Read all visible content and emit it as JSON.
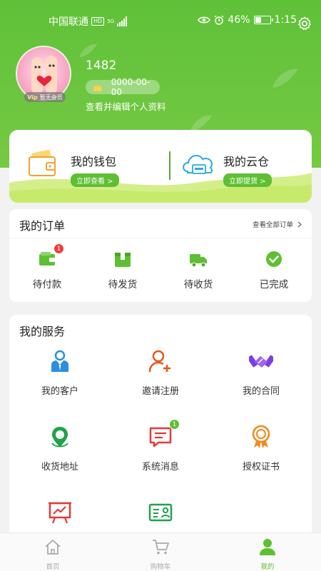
{
  "status_bar": {
    "carrier": "中国联通",
    "hd": "HD",
    "network": "5G",
    "battery": "46%",
    "time": "1:15"
  },
  "profile": {
    "username": "1482",
    "member_date": "0000-00-00",
    "vip_mark": "Vip",
    "vip_status": "暂无会员",
    "edit_link": "查看并编辑个人资料"
  },
  "wallet": {
    "title": "我的钱包",
    "button": "立即查看 >"
  },
  "cloud": {
    "title": "我的云仓",
    "button": "立即提货 >"
  },
  "orders": {
    "title": "我的订单",
    "view_all": "查看全部订单",
    "items": [
      {
        "label": "待付款",
        "badge": "1"
      },
      {
        "label": "待发货"
      },
      {
        "label": "待收货"
      },
      {
        "label": "已完成"
      }
    ]
  },
  "services": {
    "title": "我的服务",
    "items": [
      {
        "label": "我的客户",
        "icon": "customer-icon"
      },
      {
        "label": "邀请注册",
        "icon": "add-user-icon"
      },
      {
        "label": "我的合同",
        "icon": "handshake-icon"
      },
      {
        "label": "收货地址",
        "icon": "location-icon"
      },
      {
        "label": "系统消息",
        "icon": "message-icon",
        "badge": "1"
      },
      {
        "label": "授权证书",
        "icon": "certificate-icon"
      },
      {
        "label": "",
        "icon": "chart-board-icon"
      },
      {
        "label": "",
        "icon": "id-card-icon"
      }
    ]
  },
  "tabbar": {
    "items": [
      {
        "label": "首页",
        "icon": "home-icon"
      },
      {
        "label": "购物车",
        "icon": "cart-icon"
      },
      {
        "label": "我的",
        "icon": "user-icon",
        "active": true
      }
    ]
  },
  "colors": {
    "brand_green": "#5fbf33",
    "badge_red": "#f23b3b"
  }
}
